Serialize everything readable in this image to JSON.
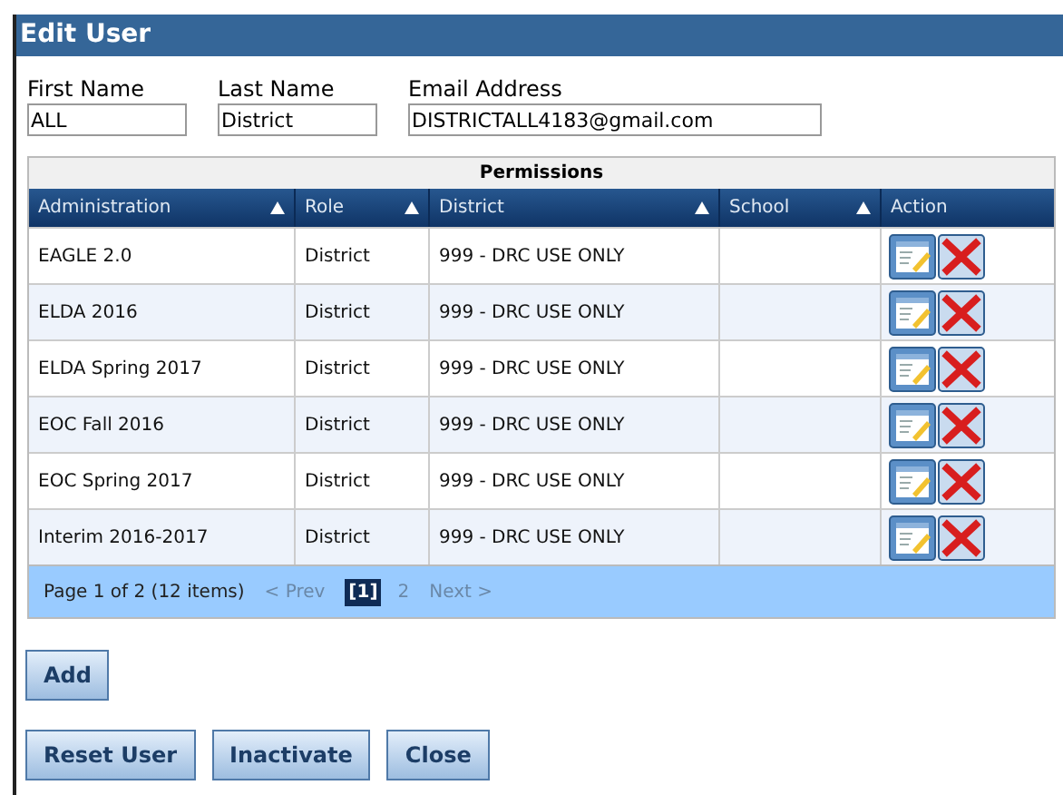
{
  "window": {
    "title": "Edit User"
  },
  "fields": [
    {
      "label": "First Name",
      "value": "ALL"
    },
    {
      "label": "Last Name",
      "value": "District"
    },
    {
      "label": "Email Address",
      "value": "DISTRICTALL4183@gmail.com"
    }
  ],
  "permissions": {
    "title": "Permissions",
    "columns": [
      {
        "label": "Administration",
        "sortable": true
      },
      {
        "label": "Role",
        "sortable": true
      },
      {
        "label": "District",
        "sortable": true
      },
      {
        "label": "School",
        "sortable": true
      },
      {
        "label": "Action",
        "sortable": false
      }
    ],
    "rows": [
      [
        "EAGLE 2.0",
        "District",
        "999 - DRC USE ONLY",
        ""
      ],
      [
        "ELDA 2016",
        "District",
        "999 - DRC USE ONLY",
        ""
      ],
      [
        "ELDA Spring 2017",
        "District",
        "999 - DRC USE ONLY",
        ""
      ],
      [
        "EOC Fall 2016",
        "District",
        "999 - DRC USE ONLY",
        ""
      ],
      [
        "EOC Spring 2017",
        "District",
        "999 - DRC USE ONLY",
        ""
      ],
      [
        "Interim 2016-2017",
        "District",
        "999 - DRC USE ONLY",
        ""
      ]
    ],
    "pager": {
      "summary": "Page 1 of 2 (12 items)",
      "prev": "< Prev",
      "pages": [
        {
          "label": "[1]",
          "selected": true
        },
        {
          "label": "2",
          "selected": false
        }
      ],
      "next": "Next >"
    }
  },
  "add_button": "Add",
  "buttons": [
    "Reset User",
    "Inactivate",
    "Close"
  ]
}
